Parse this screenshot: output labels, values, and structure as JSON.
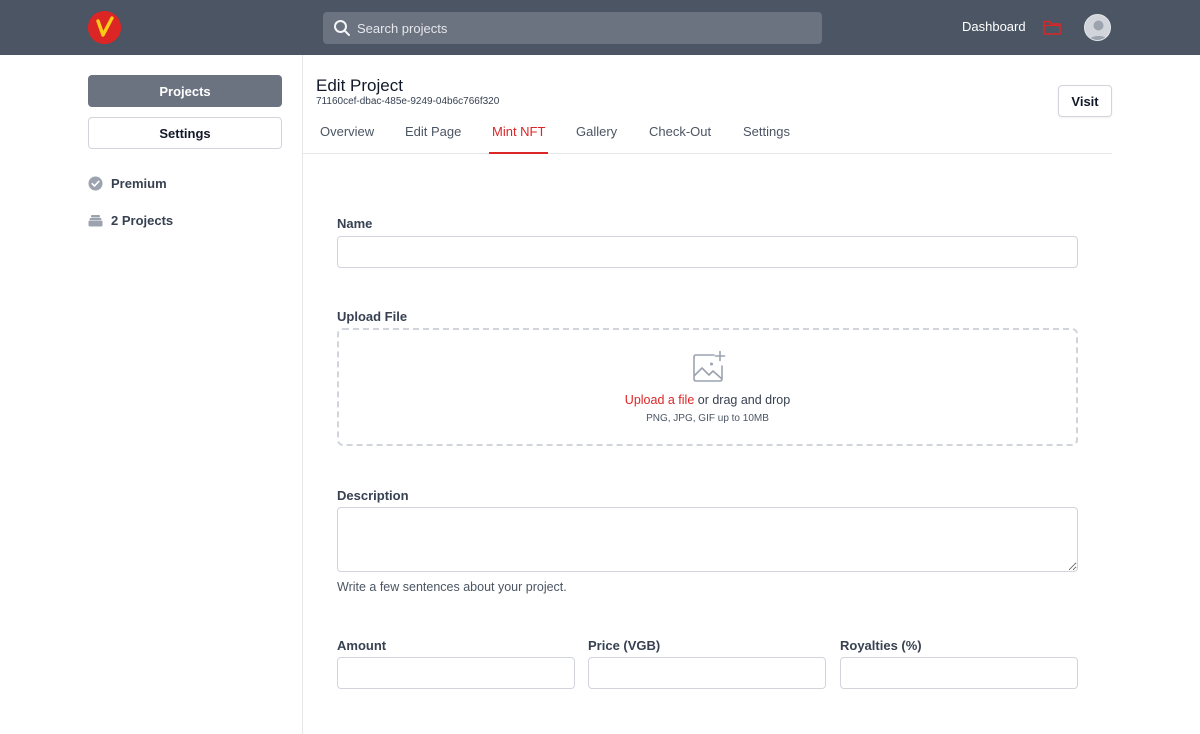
{
  "search": {
    "placeholder": "Search projects"
  },
  "topnav": {
    "dashboard": "Dashboard"
  },
  "sidebar": {
    "projects_button": "Projects",
    "settings_button": "Settings",
    "plan": "Premium",
    "projects_count": "2 Projects"
  },
  "header": {
    "title": "Edit Project",
    "project_id": "71160cef-dbac-485e-9249-04b6c766f320",
    "visit_button": "Visit"
  },
  "tabs": [
    {
      "label": "Overview"
    },
    {
      "label": "Edit Page"
    },
    {
      "label": "Mint NFT"
    },
    {
      "label": "Gallery"
    },
    {
      "label": "Check-Out"
    },
    {
      "label": "Settings"
    }
  ],
  "active_tab": "Mint NFT",
  "form": {
    "name_label": "Name",
    "name_value": "",
    "upload_label": "Upload File",
    "upload_link": "Upload a file",
    "upload_text": " or drag and drop",
    "upload_hint": "PNG, JPG, GIF up to 10MB",
    "description_label": "Description",
    "description_value": "",
    "description_hint": "Write a few sentences about your project.",
    "amount_label": "Amount",
    "amount_value": "",
    "price_label": "Price (VGB)",
    "price_value": "",
    "royalties_label": "Royalties (%)",
    "royalties_value": ""
  },
  "colors": {
    "topbar": "#4b5563",
    "accent": "#dc2626",
    "logo_mark": "#facc15",
    "sidebar_button": "#6b7280"
  },
  "icons": {
    "logo": "logo-icon",
    "search": "search-icon",
    "folder": "folder-icon",
    "avatar": "user-avatar-icon",
    "premium": "check-badge-icon",
    "projects": "stack-icon",
    "upload": "image-add-icon"
  }
}
